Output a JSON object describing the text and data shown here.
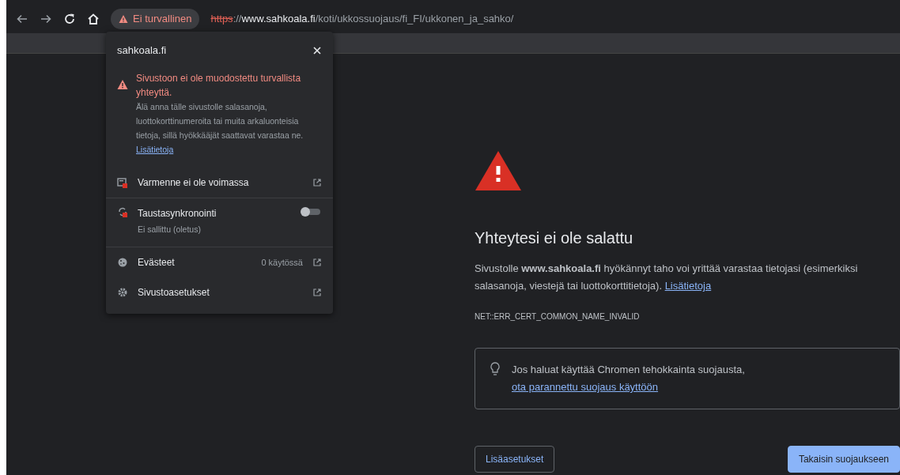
{
  "toolbar": {
    "badge": "Ei turvallinen",
    "url": [
      {
        "kind": "scheme",
        "text": "https"
      },
      {
        "kind": "dim",
        "text": "://"
      },
      {
        "kind": "host",
        "text": "www.sahkoala.fi"
      },
      {
        "kind": "dim",
        "text": "/koti/ukkossuojaus/fi_FI/ukkonen_ja_sahko/"
      }
    ]
  },
  "popup": {
    "site": "sahkoala.fi",
    "warning_title": "Sivustoon ei ole muodostettu turvallista yhteyttä.",
    "warning_text": "Älä anna tälle sivustolle salasanoja, luottokorttinumeroita tai muita arkaluonteisia tietoja, sillä hyökkääjät saattavat varastaa ne.",
    "warning_link": "Lisätietoja",
    "rows": [
      {
        "kind": "certificate",
        "label": "Varmenne ei ole voimassa"
      },
      {
        "kind": "sync",
        "label": "Taustasynkronointi",
        "sub": "Ei sallittu (oletus)",
        "on": false
      },
      {
        "kind": "cookies",
        "label": "Evästeet",
        "value": "0 käytössä"
      },
      {
        "kind": "settings",
        "label": "Sivustoasetukset"
      }
    ]
  },
  "page": {
    "heading": "Yhteytesi ei ole salattu",
    "body": "Sivustolle **www.sahkoala.fi** hyökännyt taho voi yrittää varastaa tietojasi (esimerkiksi salasanoja, viestejä tai luottokorttitietoja).",
    "body_link": "Lisätietoja",
    "error_code": "NET::ERR_CERT_COMMON_NAME_INVALID",
    "tip": "Jos haluat käyttää Chromen tehokkainta suojausta,",
    "tip_link": "ota parannettu suojaus käyttöön",
    "buttons": [
      {
        "kind": "secondary",
        "label": "Lisäasetukset"
      },
      {
        "kind": "primary",
        "label": "Takaisin suojaukseen"
      }
    ]
  }
}
